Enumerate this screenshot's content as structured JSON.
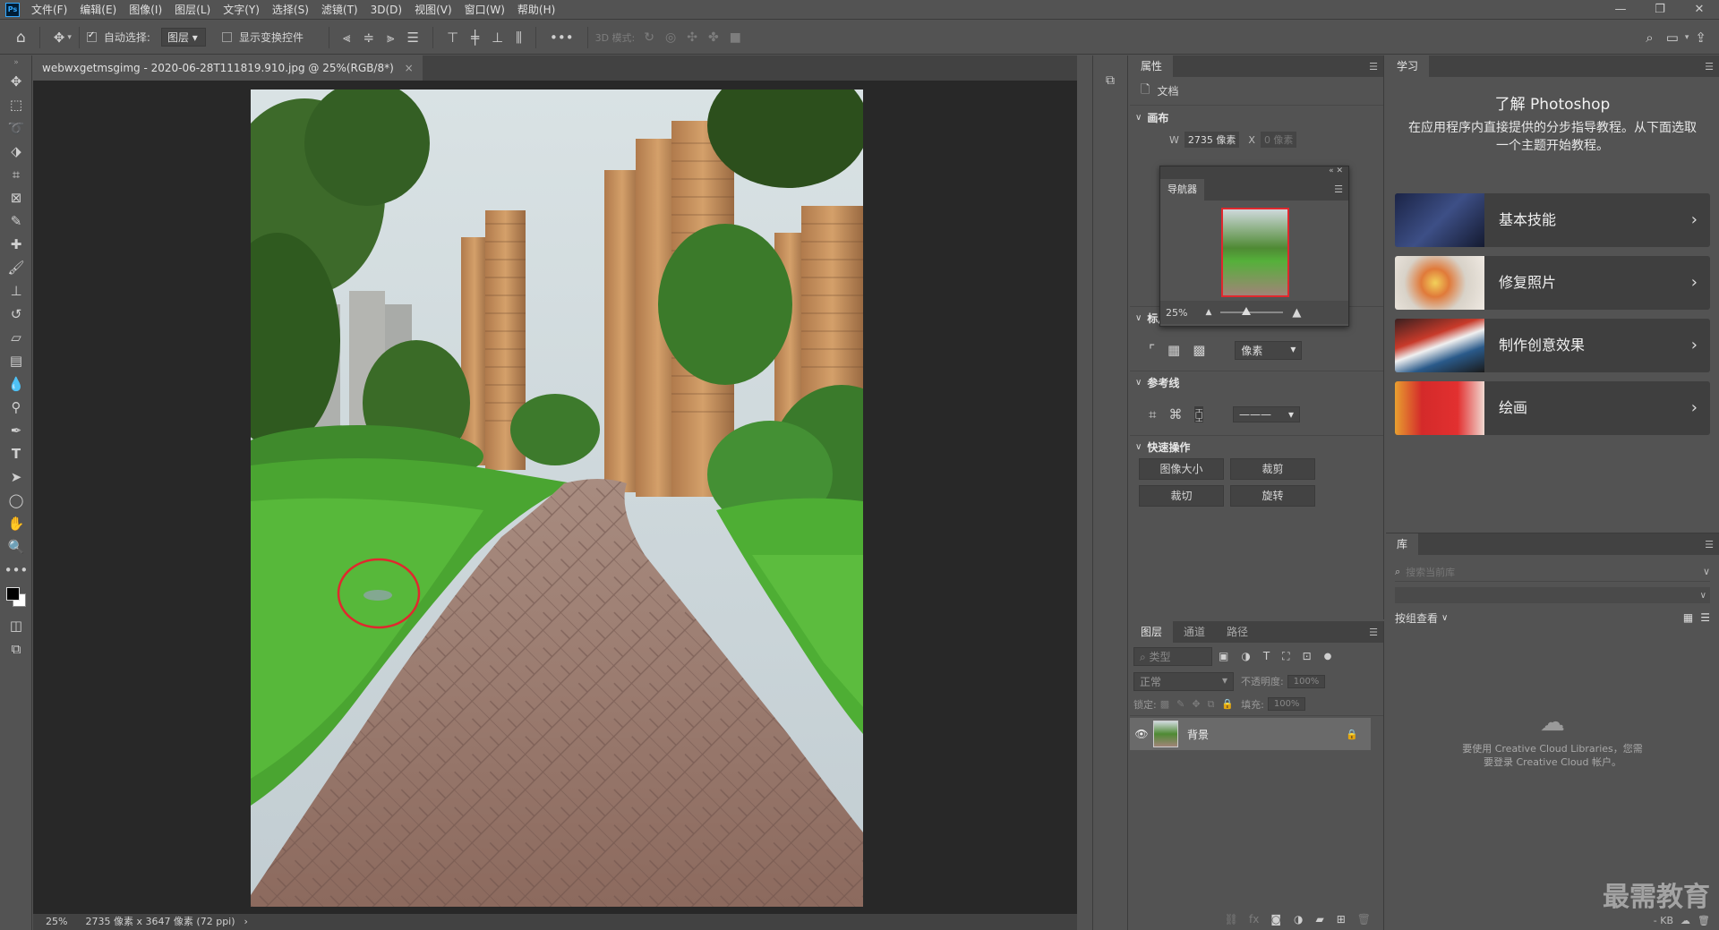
{
  "app": {
    "logo": "Ps",
    "menu": [
      "文件(F)",
      "编辑(E)",
      "图像(I)",
      "图层(L)",
      "文字(Y)",
      "选择(S)",
      "滤镜(T)",
      "3D(D)",
      "视图(V)",
      "窗口(W)",
      "帮助(H)"
    ],
    "window_controls": [
      "—",
      "❐",
      "✕"
    ]
  },
  "options": {
    "auto_select_label": "自动选择:",
    "auto_select_value": "图层",
    "show_transform_label": "显示变换控件",
    "mode_3d_label": "3D 模式:"
  },
  "document": {
    "tab_title": "webwxgetmsgimg - 2020-06-28T111819.910.jpg @ 25%(RGB/8*)",
    "tab_close": "×",
    "status_zoom": "25%",
    "status_info": "2735 像素 x 3647 像素 (72 ppi)",
    "status_arrow": "›"
  },
  "properties": {
    "tab": "属性",
    "doc_label": "文档",
    "canvas_section": "画布",
    "width_label": "W",
    "width_value": "2735 像素",
    "x_label": "X",
    "x_value": "0 像素",
    "rulers_section": "标尺和网格",
    "unit_value": "像素",
    "guides_section": "参考线",
    "quick_section": "快速操作",
    "quick_buttons": [
      "图像大小",
      "裁剪",
      "裁切",
      "旋转"
    ]
  },
  "navigator": {
    "tab": "导航器",
    "zoom": "25%"
  },
  "layers": {
    "tabs": [
      "图层",
      "通道",
      "路径"
    ],
    "filter_placeholder": "类型",
    "blend_mode": "正常",
    "opacity_label": "不透明度:",
    "opacity_value": "100%",
    "lock_label": "锁定:",
    "fill_label": "填充:",
    "fill_value": "100%",
    "layer_name": "背景"
  },
  "learn": {
    "tab": "学习",
    "title": "了解 Photoshop",
    "description": "在应用程序内直接提供的分步指导教程。从下面选取一个主题开始教程。",
    "cards": [
      "基本技能",
      "修复照片",
      "制作创意效果",
      "绘画"
    ]
  },
  "library": {
    "tab": "库",
    "search_placeholder": "搜索当前库",
    "group_by": "按组查看",
    "message": "要使用 Creative Cloud Libraries，您需要登录 Creative Cloud 帐户。",
    "size_text": "- KB"
  },
  "watermark": "最需教育",
  "colors": {
    "panel": "#535353",
    "canvas": "#282828",
    "accent": "#31a8ff",
    "marker": "#e0282e"
  }
}
